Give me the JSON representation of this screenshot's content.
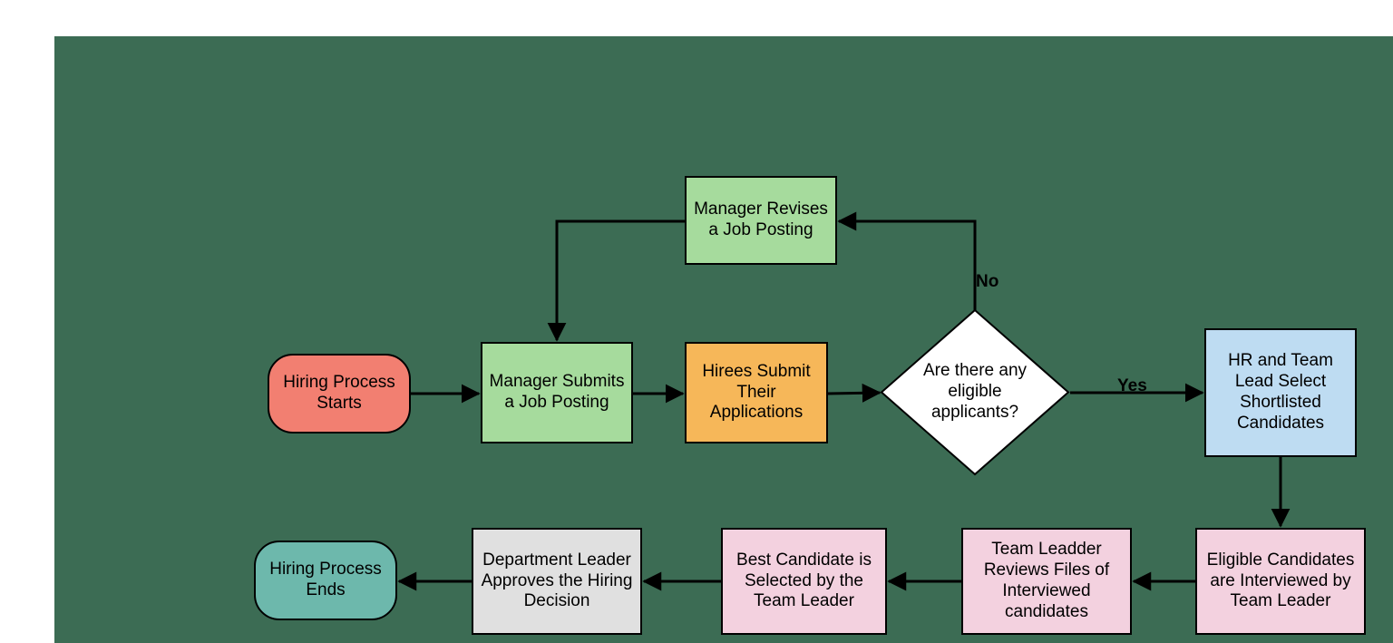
{
  "nodes": {
    "start": "Hiring Process Starts",
    "submitJob": "Manager Submits a Job Posting",
    "reviseJob": "Manager Revises a Job Posting",
    "hirees": "Hirees Submit Their Applications",
    "decision": "Are there any eligible applicants?",
    "shortlist": "HR and Team Lead Select Shortlisted Candidates",
    "interview": "Eligible Candidates are Interviewed by Team Leader",
    "reviewFiles": "Team Leadder Reviews  Files of Interviewed candidates",
    "bestCand": "Best Candidate is Selected by the Team Leader",
    "approve": "Department Leader Approves the Hiring Decision",
    "end": "Hiring Process Ends"
  },
  "edgeLabels": {
    "no": "No",
    "yes": "Yes"
  },
  "colors": {
    "start": "#f27f71",
    "green": "#a6db9d",
    "orange": "#f6b759",
    "decision": "#ffffff",
    "blue": "#bedcf2",
    "pink": "#f3d1df",
    "grey": "#e0e0e0",
    "end": "#6db8ac",
    "panel": "#3c6c54"
  }
}
